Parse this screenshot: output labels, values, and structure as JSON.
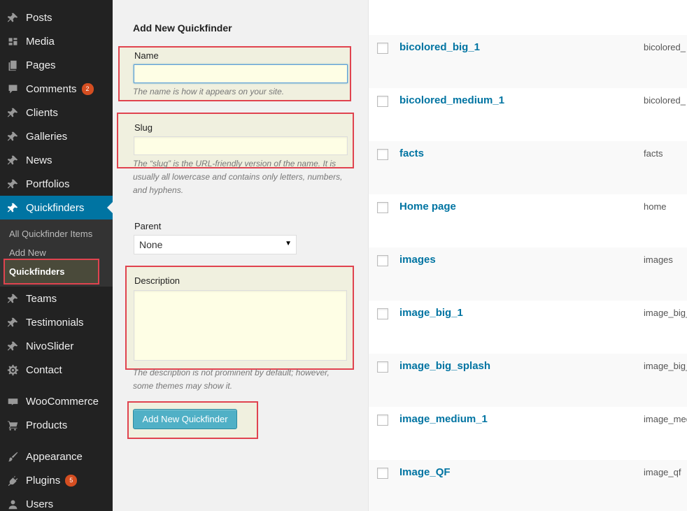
{
  "sidebar": {
    "items": [
      {
        "label": "Posts",
        "icon": "pin-icon"
      },
      {
        "label": "Media",
        "icon": "media-icon"
      },
      {
        "label": "Pages",
        "icon": "pages-icon"
      },
      {
        "label": "Comments",
        "icon": "comment-icon",
        "badge": "2"
      },
      {
        "label": "Clients",
        "icon": "pin-icon"
      },
      {
        "label": "Galleries",
        "icon": "pin-icon"
      },
      {
        "label": "News",
        "icon": "pin-icon"
      },
      {
        "label": "Portfolios",
        "icon": "pin-icon"
      },
      {
        "label": "Quickfinders",
        "icon": "pin-icon",
        "active": true
      },
      {
        "label": "Teams",
        "icon": "pin-icon"
      },
      {
        "label": "Testimonials",
        "icon": "pin-icon"
      },
      {
        "label": "NivoSlider",
        "icon": "pin-icon"
      },
      {
        "label": "Contact",
        "icon": "gear-icon"
      },
      {
        "label": "WooCommerce",
        "icon": "woo-icon"
      },
      {
        "label": "Products",
        "icon": "cart-icon"
      },
      {
        "label": "Appearance",
        "icon": "brush-icon"
      },
      {
        "label": "Plugins",
        "icon": "plug-icon",
        "badge": "5"
      },
      {
        "label": "Users",
        "icon": "user-icon"
      }
    ],
    "submenu": [
      {
        "label": "All Quickfinder Items"
      },
      {
        "label": "Add New"
      },
      {
        "label": "Quickfinders",
        "current": true
      }
    ]
  },
  "form": {
    "title": "Add New Quickfinder",
    "name_label": "Name",
    "name_value": "",
    "name_desc": "The name is how it appears on your site.",
    "slug_label": "Slug",
    "slug_value": "",
    "slug_desc_line1": "The “slug” is the URL-friendly version of the name. It is",
    "slug_desc_line2": "usually all lowercase and contains only letters, numbers,",
    "slug_desc_line3": "and hyphens.",
    "parent_label": "Parent",
    "parent_value": "None",
    "description_label": "Description",
    "description_value": "",
    "description_desc_line1": "The description is not prominent by default; however,",
    "description_desc_line2": "some themes may show it.",
    "submit_label": "Add New Quickfinder"
  },
  "list": {
    "rows": [
      {
        "title": "bicolored_big_1",
        "slug": "bicolored_"
      },
      {
        "title": "bicolored_medium_1",
        "slug": "bicolored_"
      },
      {
        "title": "facts",
        "slug": "facts"
      },
      {
        "title": "Home page",
        "slug": "home"
      },
      {
        "title": "images",
        "slug": "images"
      },
      {
        "title": "image_big_1",
        "slug": "image_big_"
      },
      {
        "title": "image_big_splash",
        "slug": "image_big_"
      },
      {
        "title": "image_medium_1",
        "slug": "image_med"
      },
      {
        "title": "Image_QF",
        "slug": "image_qf"
      }
    ]
  },
  "colors": {
    "sidebar_bg": "#222222",
    "active_menu": "#0074a2",
    "highlight_border": "#e0434f",
    "link": "#0074a2",
    "button": "#50b0c6"
  }
}
